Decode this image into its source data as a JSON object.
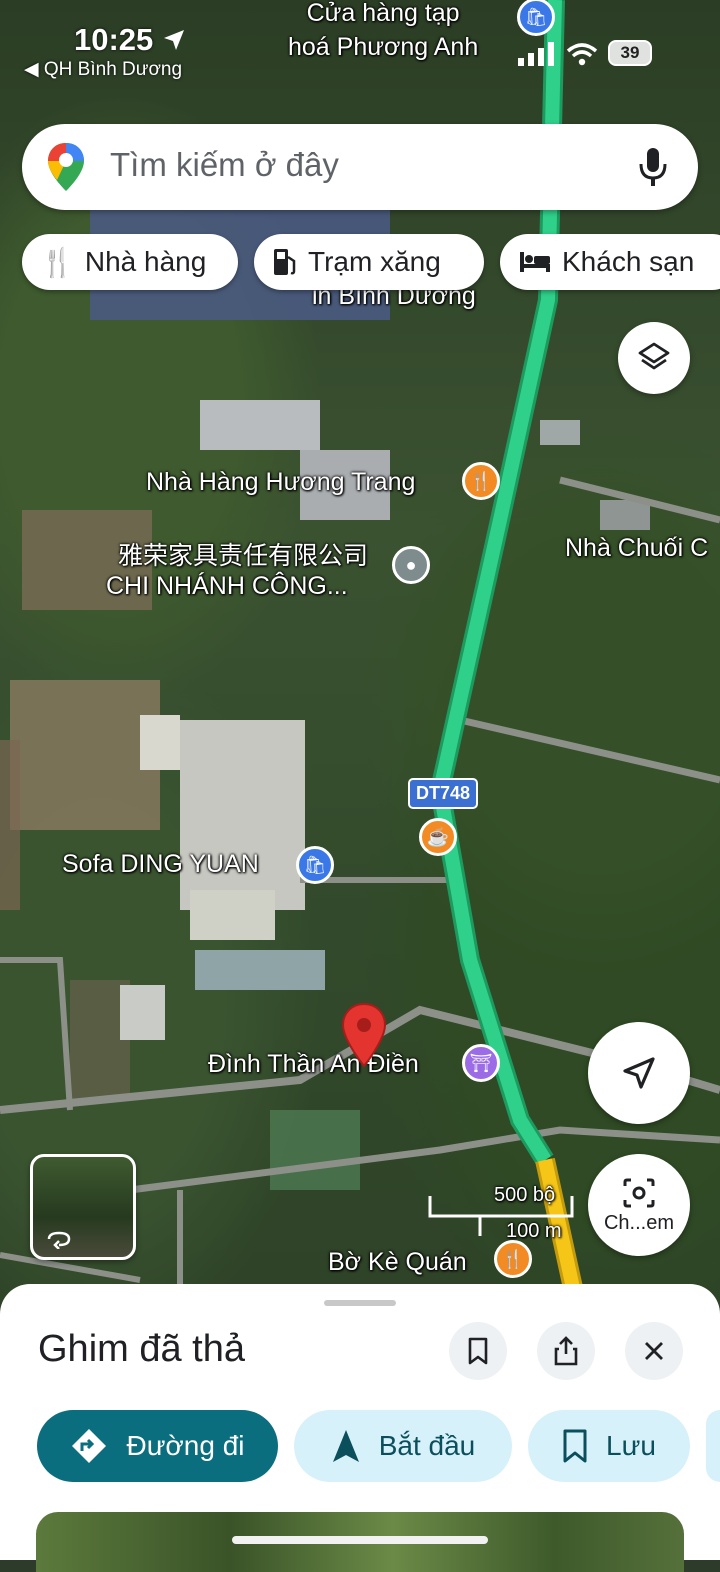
{
  "status_bar": {
    "time": "10:25",
    "back_label": "◀ QH Bình Dương",
    "battery": "39"
  },
  "search": {
    "placeholder": "Tìm kiếm ở đây"
  },
  "chips": [
    {
      "label": "Nhà hàng",
      "icon": "restaurant-icon"
    },
    {
      "label": "Trạm xăng",
      "icon": "gas-station-icon"
    },
    {
      "label": "Khách sạn",
      "icon": "hotel-icon"
    }
  ],
  "map": {
    "labels": {
      "top_store": "Cửa hàng tạp\nhoá Phương Anh",
      "binh_duong": "in Bình Dương",
      "huong_trang": "Nhà Hàng Hương Trang",
      "chinese_co": "雅荣家具责任有限公司",
      "branch": "CHI NHÁNH CÔNG...",
      "nha_chuoi": "Nhà Chuối C",
      "road_shield": "DT748",
      "sofa": "Sofa DING YUAN",
      "dinh_than": "Đình Thần An Điền",
      "bo_ke": "Bờ Kè Quán",
      "scale_ft": "500 bộ",
      "scale_m": "100 m",
      "camera_label": "Ch...em"
    },
    "colors": {
      "route": "#2fd08a",
      "route_yellow": "#f5c518",
      "poi_food": "#f28b24",
      "poi_shop": "#3b78e7",
      "poi_temple": "#9b6ce6",
      "pin": "#e3342f"
    }
  },
  "sheet": {
    "title": "Ghim đã thả",
    "actions": [
      {
        "label": "Đường đi",
        "icon": "directions-icon",
        "primary": true
      },
      {
        "label": "Bắt đầu",
        "icon": "navigation-arrow-icon",
        "primary": false
      },
      {
        "label": "Lưu",
        "icon": "bookmark-icon",
        "primary": false
      }
    ]
  }
}
